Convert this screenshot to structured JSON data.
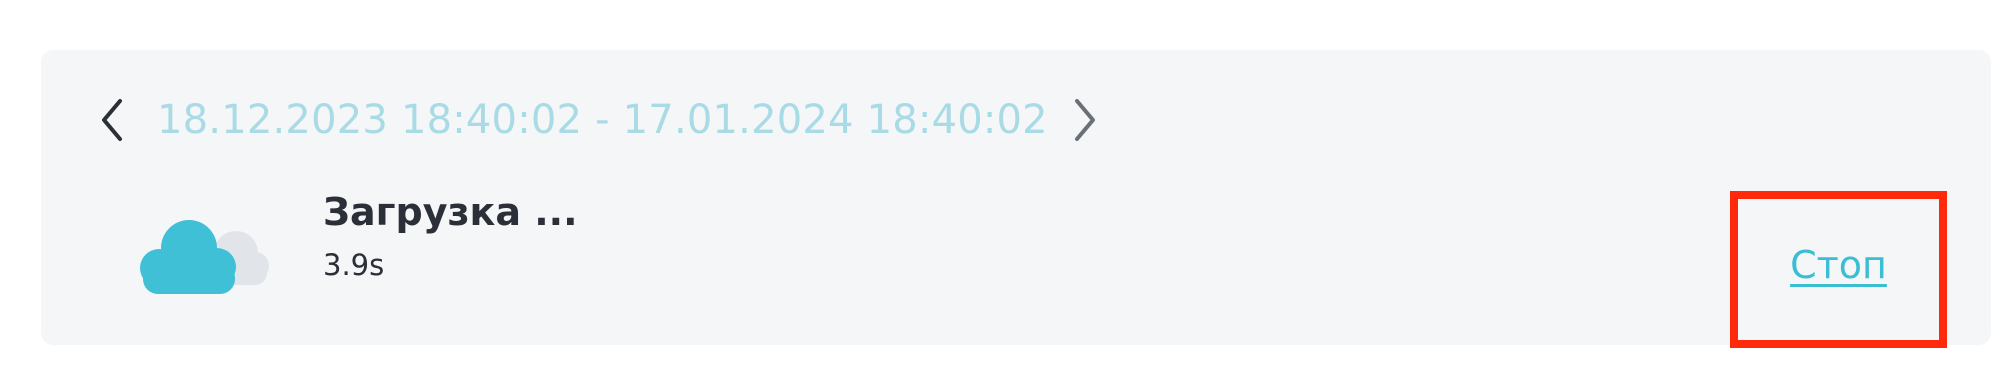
{
  "date_nav": {
    "range": "18.12.2023 18:40:02 - 17.01.2024 18:40:02",
    "prev_icon": "chevron-left-icon",
    "next_icon": "chevron-right-icon"
  },
  "status": {
    "icon": "cloud-icon",
    "title": "Загрузка ...",
    "time": "3.9s"
  },
  "actions": {
    "stop_label": "Стоп"
  },
  "colors": {
    "panel_bg": "#f4f6f8",
    "date_text": "#a8dbe6",
    "cloud_primary": "#3fc0d6",
    "cloud_secondary": "#e1e5ea",
    "link": "#3bbdd3",
    "highlight_box": "#ff2a0b",
    "text": "#2b2f38"
  }
}
